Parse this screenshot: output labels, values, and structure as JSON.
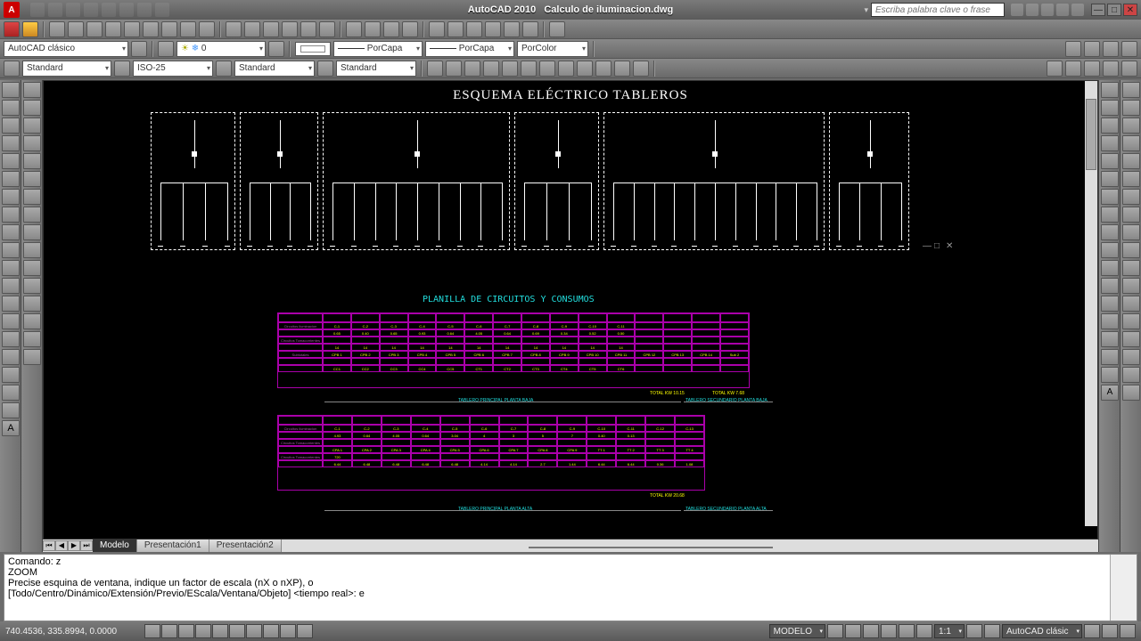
{
  "title": {
    "app": "AutoCAD 2010",
    "doc": "Calculo de iluminacion.dwg"
  },
  "search": {
    "placeholder": "Escriba palabra clave o frase"
  },
  "workspace": {
    "name": "AutoCAD clásico"
  },
  "layer": {
    "current": "0"
  },
  "linetype": {
    "label": "PorCapa"
  },
  "lineweight": {
    "label": "PorCapa"
  },
  "color": {
    "label": "PorColor"
  },
  "textstyle": {
    "label": "Standard"
  },
  "dimstyle": {
    "label": "ISO-25"
  },
  "tablestyle": {
    "label": "Standard"
  },
  "mlstyle": {
    "label": "Standard"
  },
  "drawing": {
    "title": "ESQUEMA ELÉCTRICO TABLEROS",
    "section2": "PLANILLA DE CIRCUITOS Y CONSUMOS",
    "floor1": "PLANTA BAJA",
    "floor2": "PLANTA ALTA",
    "dim1": "TABLERO PRINCIPAL PLANTA BAJA",
    "dim2": "TABLERO SECUNDARIO PLANTA BAJA",
    "dim3": "TABLERO PRINCIPAL PLANTA ALTA",
    "dim4": "TABLERO SECUNDARIO PLANTA ALTA",
    "total1": "TOTAL KW 10.15",
    "total2": "TOTAL KW 7.68",
    "total3": "TOTAL KW 20.68"
  },
  "tabs": {
    "model": "Modelo",
    "layout1": "Presentación1",
    "layout2": "Presentación2"
  },
  "command": {
    "l1": "Comando: z",
    "l2": "ZOOM",
    "l3": "Precise esquina de ventana, indique un factor de escala (nX o nXP), o",
    "l4": "[Todo/Centro/Dinámico/Extensión/Previo/EScala/Ventana/Objeto] <tiempo real>: e"
  },
  "status": {
    "coords": "740.4536, 335.8994, 0.0000",
    "model": "MODELO",
    "scale": "1:1",
    "ws": "AutoCAD clásic"
  }
}
